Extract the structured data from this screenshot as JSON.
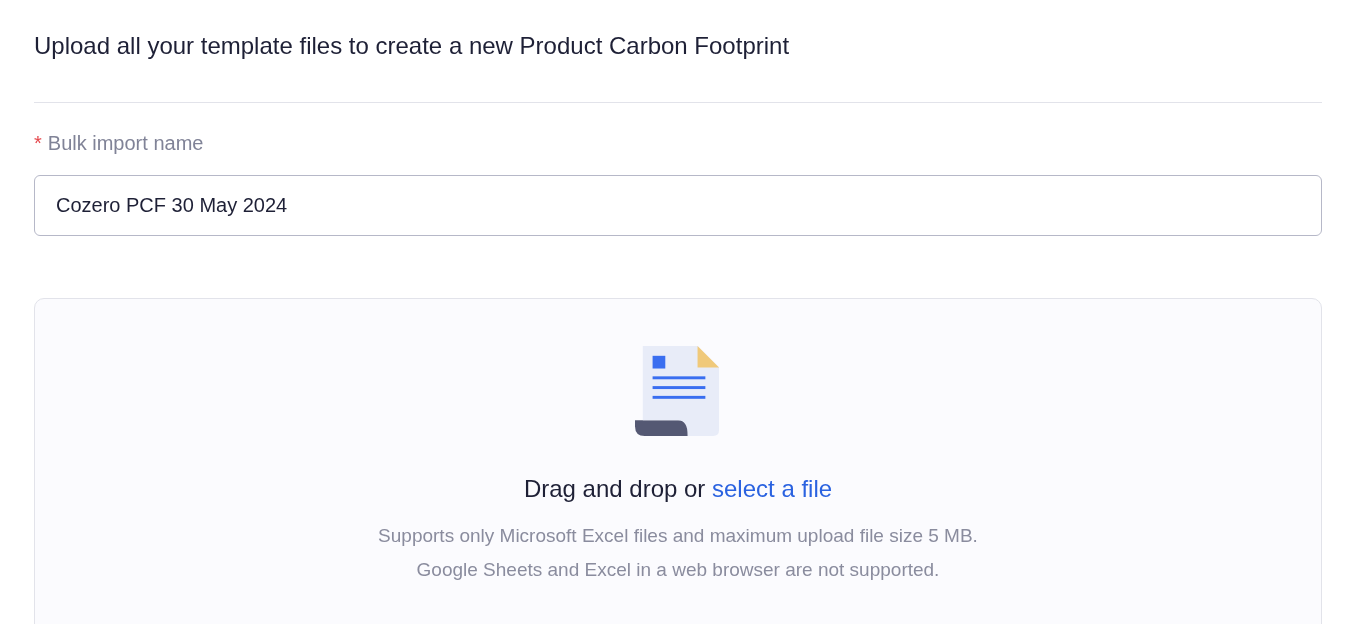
{
  "heading": "Upload all your template files to create a new Product Carbon Footprint",
  "field": {
    "required_mark": "*",
    "label": "Bulk import name",
    "value": "Cozero PCF 30 May 2024"
  },
  "dropzone": {
    "prompt": "Drag and drop or ",
    "link": "select a file",
    "notes": [
      "Supports only Microsoft Excel files and maximum upload file size 5 MB.",
      "Google Sheets and Excel in a web browser are not supported."
    ]
  }
}
